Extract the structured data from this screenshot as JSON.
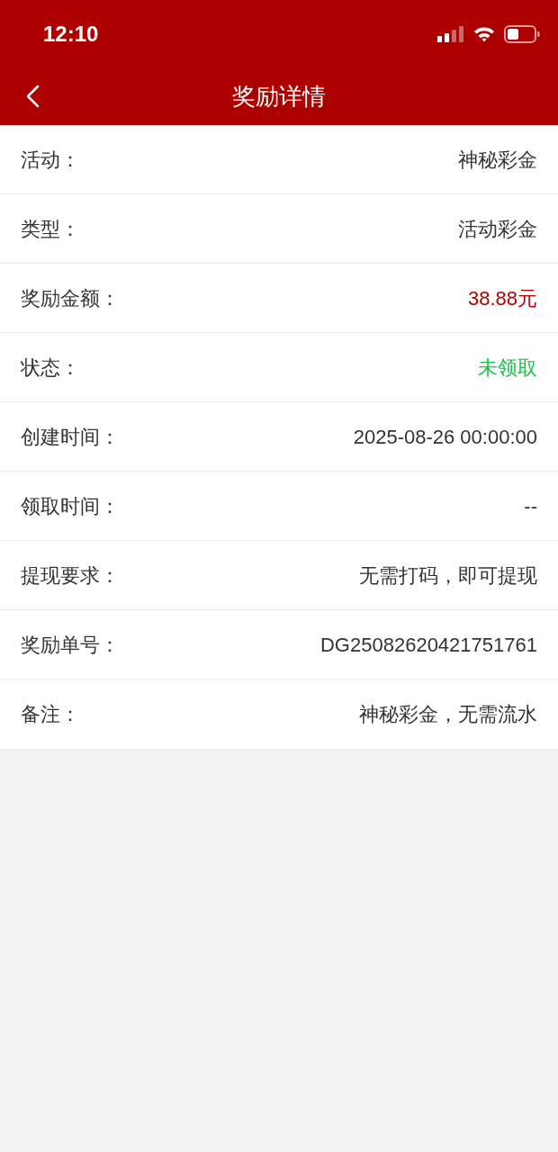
{
  "status_bar": {
    "time": "12:10"
  },
  "nav": {
    "title": "奖励详情"
  },
  "rows": [
    {
      "label": "活动：",
      "value": "神秘彩金",
      "kind": "text"
    },
    {
      "label": "类型：",
      "value": "活动彩金",
      "kind": "text"
    },
    {
      "label": "奖励金额：",
      "value": "38.88元",
      "kind": "amount"
    },
    {
      "label": "状态：",
      "value": "未领取",
      "kind": "status"
    },
    {
      "label": "创建时间：",
      "value": "2025-08-26 00:00:00",
      "kind": "text"
    },
    {
      "label": "领取时间：",
      "value": "--",
      "kind": "text"
    },
    {
      "label": "提现要求：",
      "value": "无需打码，即可提现",
      "kind": "text"
    },
    {
      "label": "奖励单号：",
      "value": "DG25082620421751761",
      "kind": "text"
    },
    {
      "label": "备注：",
      "value": "神秘彩金，无需流水",
      "kind": "text"
    }
  ]
}
